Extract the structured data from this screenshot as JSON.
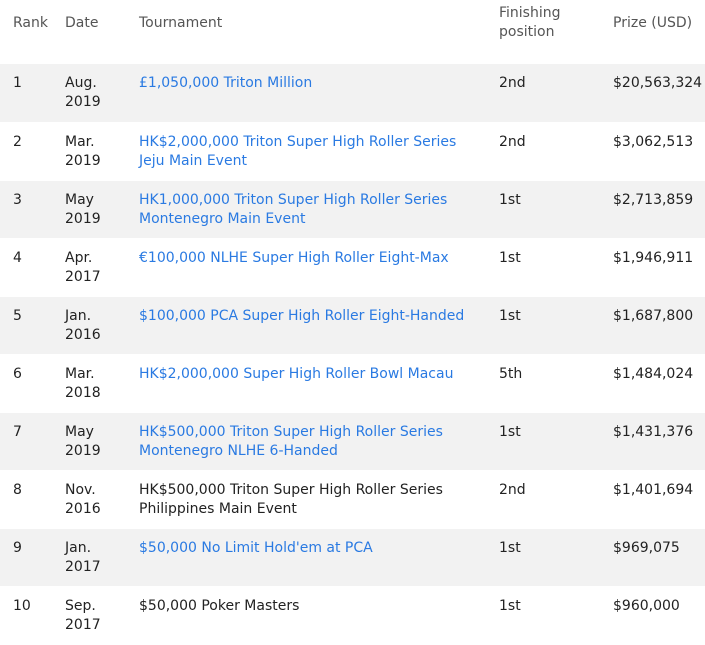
{
  "headers": {
    "rank": "Rank",
    "date": "Date",
    "tournament": "Tournament",
    "finishing": "Finishing position",
    "prize": "Prize (USD)"
  },
  "rows": [
    {
      "rank": "1",
      "date": "Aug. 2019",
      "tournament": "£1,050,000 Triton Million",
      "link": true,
      "position": "2nd",
      "prize": "$20,563,324"
    },
    {
      "rank": "2",
      "date": "Mar. 2019",
      "tournament": "HK$2,000,000 Triton Super High Roller Series Jeju Main Event",
      "link": true,
      "position": "2nd",
      "prize": "$3,062,513"
    },
    {
      "rank": "3",
      "date": "May 2019",
      "tournament": "HK1,000,000 Triton Super High Roller Series Montenegro Main Event",
      "link": true,
      "position": "1st",
      "prize": "$2,713,859"
    },
    {
      "rank": "4",
      "date": "Apr. 2017",
      "tournament": "€100,000 NLHE Super High Roller Eight-Max",
      "link": true,
      "position": "1st",
      "prize": "$1,946,911"
    },
    {
      "rank": "5",
      "date": "Jan. 2016",
      "tournament": "$100,000 PCA Super High Roller Eight-Handed",
      "link": true,
      "position": "1st",
      "prize": "$1,687,800"
    },
    {
      "rank": "6",
      "date": "Mar. 2018",
      "tournament": "HK$2,000,000 Super High Roller Bowl Macau",
      "link": true,
      "position": "5th",
      "prize": "$1,484,024"
    },
    {
      "rank": "7",
      "date": "May 2019",
      "tournament": "HK$500,000 Triton Super High Roller Series Montenegro NLHE 6-Handed",
      "link": true,
      "position": "1st",
      "prize": "$1,431,376"
    },
    {
      "rank": "8",
      "date": "Nov. 2016",
      "tournament": "HK$500,000 Triton Super High Roller Series Philippines Main Event",
      "link": false,
      "position": "2nd",
      "prize": "$1,401,694"
    },
    {
      "rank": "9",
      "date": "Jan. 2017",
      "tournament": "$50,000 No Limit Hold'em at PCA",
      "link": true,
      "position": "1st",
      "prize": "$969,075"
    },
    {
      "rank": "10",
      "date": "Sep. 2017",
      "tournament": "$50,000 Poker Masters",
      "link": false,
      "position": "1st",
      "prize": "$960,000"
    }
  ],
  "colors": {
    "link": "#2a7ae2",
    "stripe": "#f2f2f2",
    "header_text": "#555555"
  }
}
